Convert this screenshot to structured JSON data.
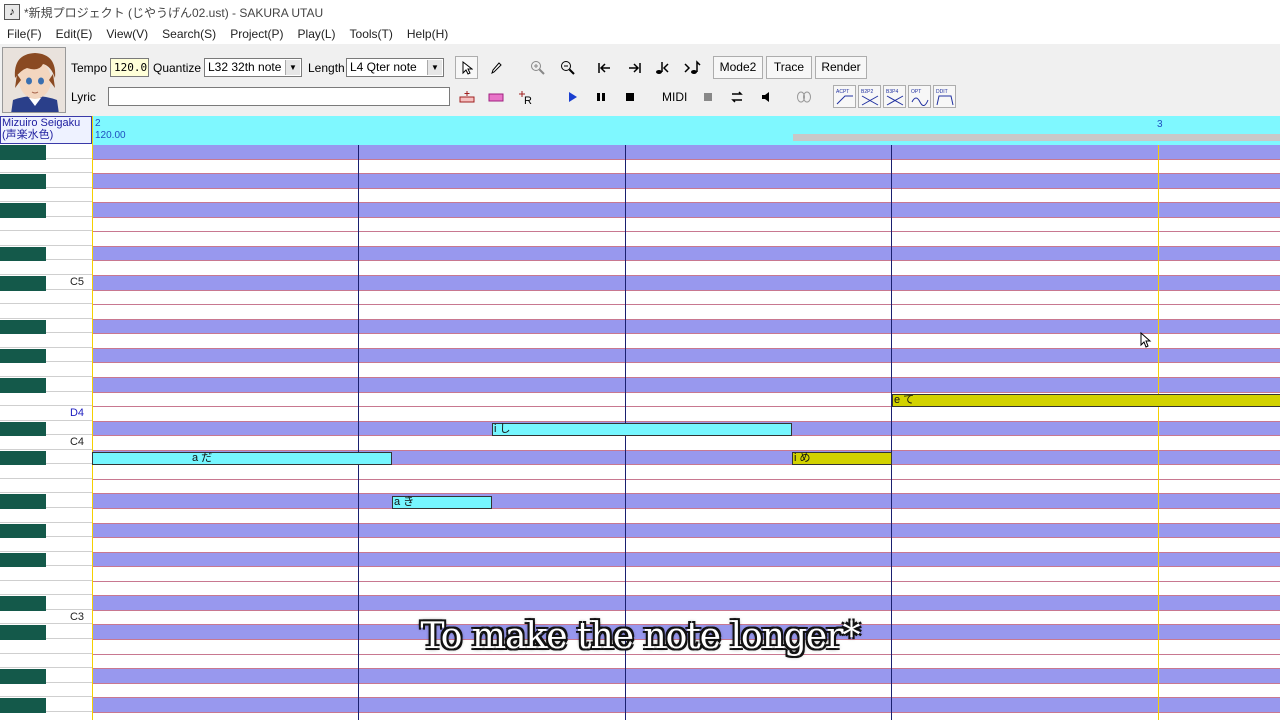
{
  "window": {
    "title": "*新規プロジェクト (じやうげん02.ust) - SAKURA UTAU",
    "icon_glyph": "♪"
  },
  "menu": [
    "File(F)",
    "Edit(E)",
    "View(V)",
    "Search(S)",
    "Project(P)",
    "Play(L)",
    "Tools(T)",
    "Help(H)"
  ],
  "toolbar": {
    "tempo_label": "Tempo",
    "tempo_value": "120.0",
    "quantize_label": "Quantize",
    "quantize_value": "L32 32th note",
    "length_label": "Length",
    "length_value": "L4  Qter note",
    "lyric_label": "Lyric",
    "lyric_value": "",
    "midi_label": "MIDI",
    "mode2_label": "Mode2",
    "trace_label": "Trace",
    "render_label": "Render",
    "fx_labels": [
      "ACPT",
      "B2P2",
      "B3P4",
      "OPT",
      "DDIT"
    ]
  },
  "singer": {
    "name": "Mizuiro Seigaku",
    "subname": "(声楽水色)"
  },
  "keys": {
    "c5": "C5",
    "d4": "D4",
    "c4": "C4",
    "c3": "C3"
  },
  "ruler": {
    "measure_start": "2",
    "measure_end": "3",
    "tempo": "120.00"
  },
  "notes": [
    {
      "lyric": "a だ",
      "color": "cyan"
    },
    {
      "lyric": "a き",
      "color": "cyan"
    },
    {
      "lyric": "i し",
      "color": "cyan"
    },
    {
      "lyric": "i め",
      "color": "yellow"
    },
    {
      "lyric": "e て",
      "color": "yellow"
    }
  ],
  "caption": "To make the note longer*",
  "colors": {
    "ruler": "#7ff8ff",
    "row_dark": "#9898ee",
    "row_line": "#c87890",
    "note_cyan": "#76f6ff",
    "note_yellow": "#d2d200",
    "black_key": "#14594a"
  }
}
